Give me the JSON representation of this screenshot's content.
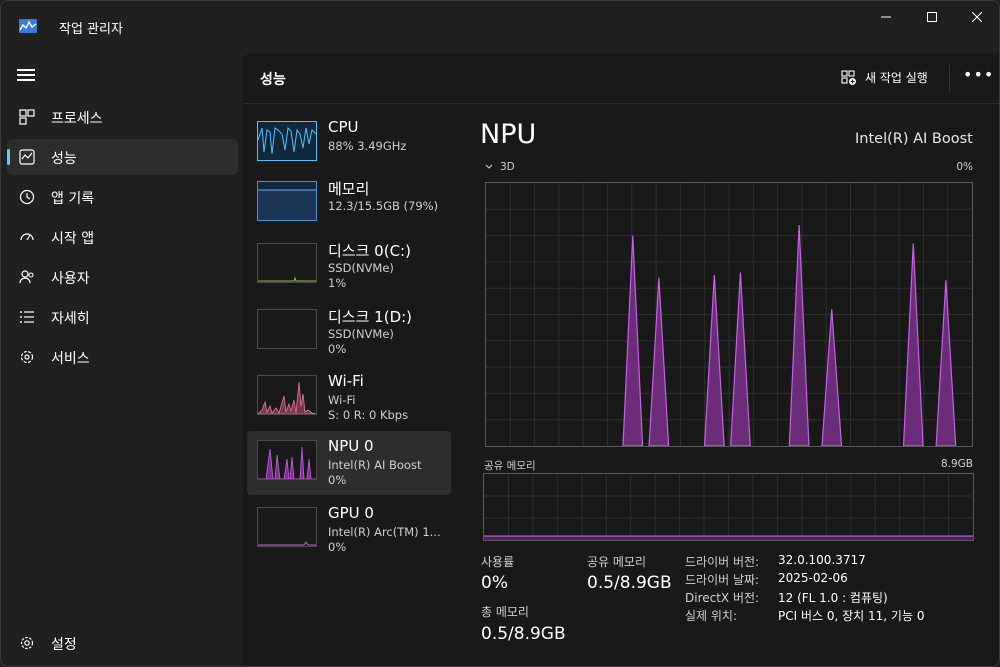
{
  "app": {
    "title": "작업 관리자"
  },
  "window_controls": {
    "minimize": "—",
    "maximize": "☐",
    "close": "✕"
  },
  "sidebar": {
    "items": [
      {
        "label": "프로세스",
        "icon": "processes-icon"
      },
      {
        "label": "성능",
        "icon": "performance-icon",
        "active": true
      },
      {
        "label": "앱 기록",
        "icon": "app-history-icon"
      },
      {
        "label": "시작 앱",
        "icon": "startup-apps-icon"
      },
      {
        "label": "사용자",
        "icon": "users-icon"
      },
      {
        "label": "자세히",
        "icon": "details-icon"
      },
      {
        "label": "서비스",
        "icon": "services-icon"
      }
    ],
    "settings_label": "설정"
  },
  "header": {
    "title": "성능",
    "run_task_label": "새 작업 실행",
    "more_label": "•••"
  },
  "resources": [
    {
      "name": "CPU",
      "lines": [
        "88% 3.49GHz"
      ],
      "color": "#4cc2ff"
    },
    {
      "name": "메모리",
      "lines": [
        "12.3/15.5GB (79%)"
      ],
      "color": "#4c8fd6"
    },
    {
      "name": "디스크 0(C:)",
      "lines": [
        "SSD(NVMe)",
        "1%"
      ],
      "color": "#8fbf4c"
    },
    {
      "name": "디스크 1(D:)",
      "lines": [
        "SSD(NVMe)",
        "0%"
      ],
      "color": "#8fbf4c"
    },
    {
      "name": "Wi-Fi",
      "lines": [
        "Wi-Fi",
        "S: 0 R: 0 Kbps"
      ],
      "color": "#e07a9a"
    },
    {
      "name": "NPU 0",
      "lines": [
        "Intel(R) AI Boost",
        "0%"
      ],
      "color": "#c563e0",
      "active": true
    },
    {
      "name": "GPU 0",
      "lines": [
        "Intel(R) Arc(TM) 1...",
        "0%"
      ],
      "color": "#c563e0"
    }
  ],
  "detail": {
    "title": "NPU",
    "device": "Intel(R) AI Boost",
    "engine_label": "3D",
    "engine_max": "0%",
    "shared_mem_label": "공유 메모리",
    "shared_mem_max": "8.9GB",
    "stats": {
      "utilization_label": "사용률",
      "utilization_value": "0%",
      "shared_label": "공유 메모리",
      "shared_value": "0.5/8.9GB",
      "total_label": "총 메모리",
      "total_value": "0.5/8.9GB"
    },
    "info": [
      {
        "key": "드라이버 버전:",
        "value": "32.0.100.3717"
      },
      {
        "key": "드라이버 날짜:",
        "value": "2025-02-06"
      },
      {
        "key": "DirectX 버전:",
        "value": "12 (FL 1.0 : 컴퓨팅)"
      },
      {
        "key": "실제 위치:",
        "value": "PCI 버스 0, 장치 11, 기능 0"
      }
    ]
  },
  "chart_data": {
    "type": "area",
    "series": [
      {
        "name": "3D",
        "values": [
          0,
          0,
          0,
          0,
          0,
          0,
          0,
          0,
          0,
          0,
          0,
          0,
          0,
          0,
          0,
          0,
          0,
          0,
          0,
          0,
          0,
          0,
          0,
          0,
          0,
          0,
          0,
          0,
          0,
          0,
          0,
          0,
          0,
          0,
          0,
          0,
          0,
          0,
          0,
          0,
          0,
          0,
          0,
          0,
          0,
          0,
          0,
          0,
          0,
          0,
          0,
          0,
          0,
          0,
          0,
          0,
          0,
          0,
          0,
          0,
          0,
          0,
          0,
          0,
          0,
          0,
          0,
          0,
          0,
          0,
          0,
          0,
          0,
          0,
          0,
          0,
          0,
          0,
          0,
          0,
          0,
          0,
          0,
          0,
          0,
          0,
          0,
          0,
          0,
          0,
          0,
          0,
          0,
          0,
          0,
          0,
          0,
          0,
          0,
          0,
          0,
          0,
          0,
          0,
          0,
          0,
          0,
          0,
          0,
          0,
          0,
          0,
          0,
          0,
          0,
          0,
          0,
          0,
          0,
          0,
          0,
          0,
          0,
          0,
          0,
          0,
          0,
          0,
          0,
          0,
          0,
          0,
          0,
          0,
          0,
          0,
          0,
          0,
          0,
          0,
          0,
          0,
          0,
          0,
          0,
          0,
          0,
          0,
          0,
          0
        ],
        "peaks_percent": [
          {
            "x": 45,
            "y": 80
          },
          {
            "x": 53,
            "y": 64
          },
          {
            "x": 70,
            "y": 65
          },
          {
            "x": 78,
            "y": 66
          },
          {
            "x": 96,
            "y": 84
          },
          {
            "x": 106,
            "y": 52
          },
          {
            "x": 131,
            "y": 77
          },
          {
            "x": 141,
            "y": 63
          }
        ]
      },
      {
        "name": "공유 메모리",
        "values": [
          6,
          6,
          6,
          6,
          6,
          6
        ]
      }
    ],
    "ylim": [
      0,
      100
    ],
    "grid": true
  }
}
